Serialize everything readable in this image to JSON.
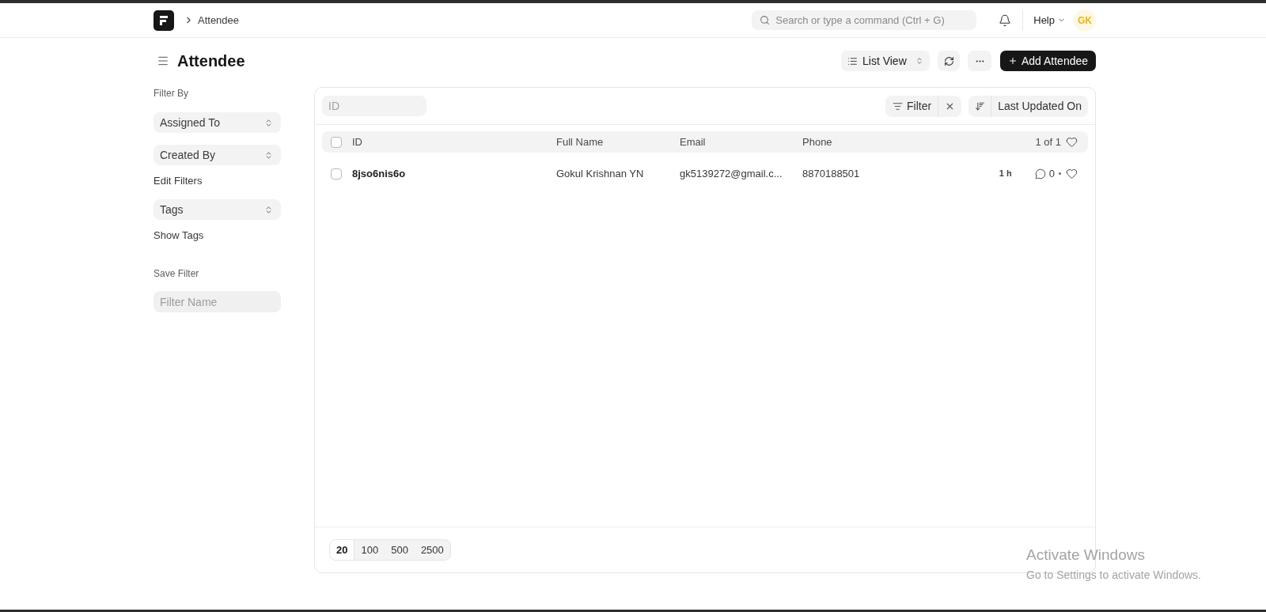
{
  "navbar": {
    "breadcrumbs": [
      "Attendee"
    ],
    "search": {
      "placeholder": "Search or type a command (Ctrl + G)"
    },
    "help": "Help",
    "avatar": "GK"
  },
  "page_head": {
    "title": "Attendee",
    "view_switcher": "List View",
    "primary_button": "Add Attendee"
  },
  "sidebar": {
    "items": [
      {
        "kind": "heading",
        "label": "Filter By"
      },
      {
        "kind": "select",
        "label": "Assigned To"
      },
      {
        "kind": "select",
        "label": "Created By"
      },
      {
        "kind": "link",
        "label": "Edit Filters"
      },
      {
        "kind": "select",
        "label": "Tags"
      },
      {
        "kind": "link",
        "label": "Show Tags"
      },
      {
        "kind": "heading",
        "label": "Save Filter"
      },
      {
        "kind": "input",
        "placeholder": "Filter Name"
      }
    ]
  },
  "list": {
    "id_filter": {
      "placeholder": "ID"
    },
    "filter_button": "Filter",
    "sort_button": "Last Updated On",
    "select_all": {
      "checked": false
    },
    "columns": [
      "ID",
      "Full Name",
      "Email",
      "Phone"
    ],
    "count": "1 of 1",
    "rows": [
      {
        "checked": false,
        "cells": [
          "8jso6nis6o",
          "Gokul Krishnan YN",
          "gk5139272@gmail.c...",
          "8870188501"
        ],
        "modified": "1 h",
        "comments": "0"
      }
    ],
    "page_lengths": [
      {
        "label": "20",
        "selected": true
      },
      {
        "label": "100",
        "selected": false
      },
      {
        "label": "500",
        "selected": false
      },
      {
        "label": "2500",
        "selected": false
      }
    ]
  },
  "os_notice": {
    "title": "Activate Windows",
    "message": "Go to Settings to activate Windows."
  }
}
